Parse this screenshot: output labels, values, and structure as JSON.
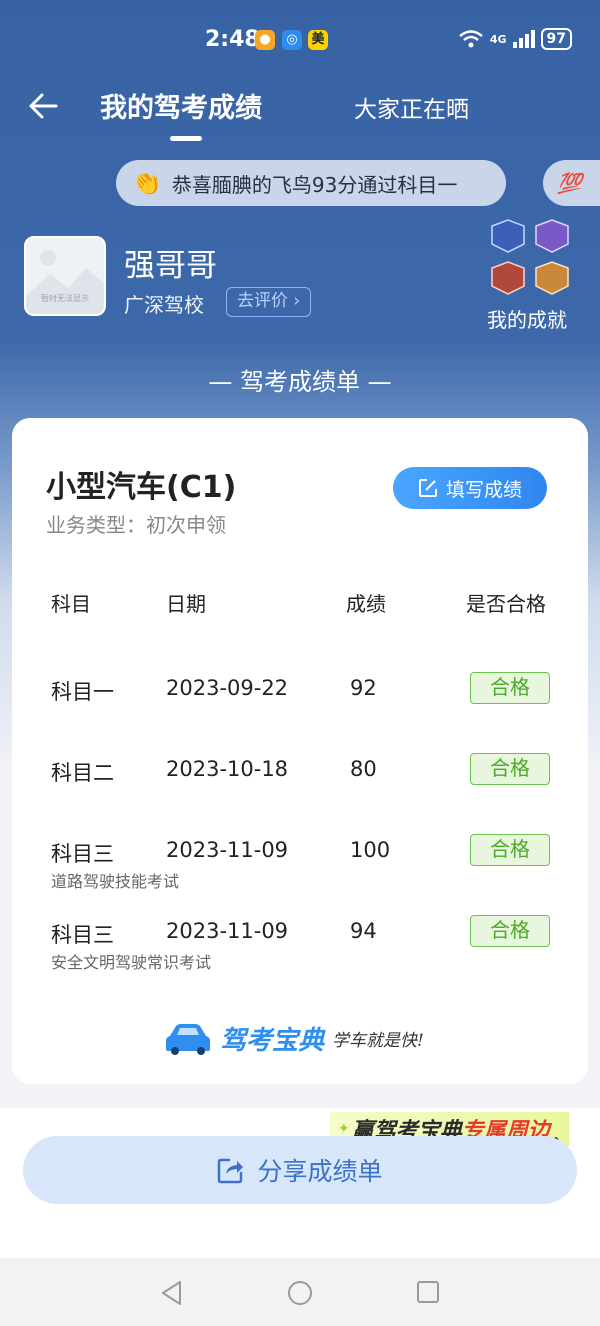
{
  "status_bar": {
    "time": "2:48",
    "apps": [
      {
        "name": "app-icon-1",
        "glyph": "",
        "color": "#f5a623"
      },
      {
        "name": "app-icon-2",
        "glyph": "",
        "color": "#2d8cf0"
      },
      {
        "name": "app-icon-3",
        "glyph": "美",
        "color": "#ffd100"
      }
    ],
    "network": "4G",
    "battery": "97"
  },
  "header": {
    "title": "我的驾考成绩",
    "other_tab": "大家正在晒"
  },
  "ticker": {
    "message": "恭喜腼腆的飞鸟93分通过科目一",
    "next_icon": "💯"
  },
  "user": {
    "avatar_placeholder": "暂时无法显示",
    "name": "强哥哥",
    "school": "广深驾校",
    "review_label": "去评价",
    "achievements_label": "我的成就"
  },
  "report_title": "— 驾考成绩单 —",
  "card": {
    "vehicle": "小型汽车(C1)",
    "business_type": "业务类型：初次申领",
    "fill_button": "填写成绩",
    "columns": [
      "科目",
      "日期",
      "成绩",
      "是否合格"
    ],
    "rows": [
      {
        "subject": "科目一",
        "date": "2023-09-22",
        "score": "92",
        "status": "合格",
        "note": ""
      },
      {
        "subject": "科目二",
        "date": "2023-10-18",
        "score": "80",
        "status": "合格",
        "note": ""
      },
      {
        "subject": "科目三",
        "date": "2023-11-09",
        "score": "100",
        "status": "合格",
        "note": "道路驾驶技能考试"
      },
      {
        "subject": "科目三",
        "date": "2023-11-09",
        "score": "94",
        "status": "合格",
        "note": "安全文明驾驶常识考试"
      }
    ],
    "brand_name": "驾考宝典",
    "brand_slogan": "学车就是快!"
  },
  "promo": {
    "part1": "赢驾考宝典",
    "part2": "专属周边"
  },
  "share_button": "分享成绩单",
  "colors": {
    "header_blue": "#3763a5",
    "accent_blue": "#2f86f0",
    "pass_green": "#4caa2a"
  }
}
